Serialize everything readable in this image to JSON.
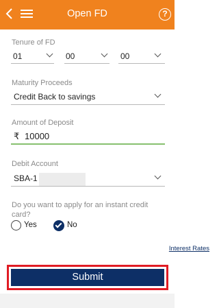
{
  "colors": {
    "app_bar": "#f0821e",
    "primary": "#0d2f66",
    "focus_underline": "#86c06f",
    "highlight": "#e01b24"
  },
  "header": {
    "title": "Open FD",
    "back_icon": "chevron-left-icon",
    "menu_icon": "hamburger-menu-icon",
    "help_icon": "question-circle-icon",
    "help_glyph": "?"
  },
  "tenure": {
    "label": "Tenure of FD",
    "values": [
      "01",
      "00",
      "00"
    ]
  },
  "maturity": {
    "label": "Maturity Proceeds",
    "value": "Credit Back to savings"
  },
  "amount": {
    "label": "Amount of Deposit",
    "currency": "₹",
    "value": "10000"
  },
  "debit": {
    "label": "Debit Account",
    "value": "SBA-1"
  },
  "instant_credit": {
    "question": "Do you want to apply for an instant credit card?",
    "options": [
      "Yes",
      "No"
    ],
    "selected": "No"
  },
  "interest_link": "Interest Rates",
  "submit_label": "Submit"
}
